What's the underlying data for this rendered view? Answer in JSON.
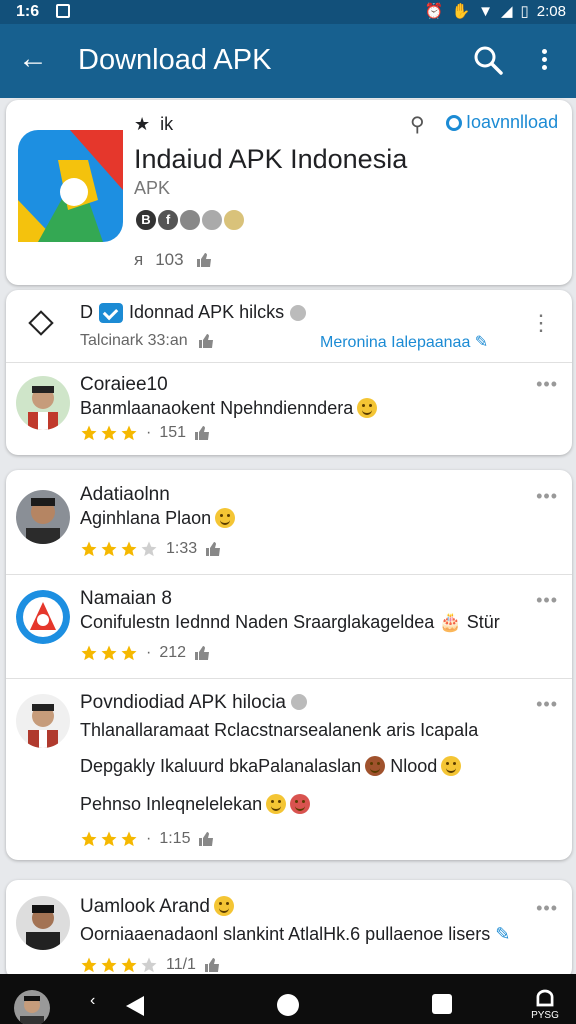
{
  "status_bar": {
    "time": "1:6",
    "clock": "2:08",
    "battery": "▯"
  },
  "app_bar": {
    "title": "Download APK",
    "back_icon": "arrow-left-icon",
    "search_icon": "search-icon",
    "more_icon": "more-vert-icon"
  },
  "app_card": {
    "tag": "ik",
    "download_label": "Ioavnnlload",
    "name": "Indaiud APK Indonesia",
    "subtitle": "APK",
    "badges": [
      "B",
      "f",
      "",
      "",
      ""
    ],
    "meta_prefix": "ᴙ",
    "meta_count": "103"
  },
  "list_header": {
    "prefix": "D",
    "title": "Idonnad APK hilcks",
    "time": "Talcinark 33:an",
    "link": "Meronina Ialepaanaa"
  },
  "reviews": [
    {
      "name": "Coraiee10",
      "text": "Banmlaanaokent Npehndienndera",
      "count": "151",
      "rating": 3
    },
    {
      "name": "Adatiaolnn",
      "text": "Aginhlana Plaon",
      "count": "1:33",
      "rating": 3.5
    },
    {
      "name": "Namaian 8",
      "text": "Conifulestn Iednnd Naden Sraarglakageldea",
      "text_suffix": "Stür",
      "count": "212",
      "rating": 3
    },
    {
      "name": "Povndiodiad APK hilocia",
      "text": "Thlanallaramaat Rclacstnarsealanenk aris Icapala",
      "text_2": "Depgakly Ikaluurd bkaPalanalaslan",
      "text_2_suffix": "Nlood",
      "text_3": "Pehnso Inleqnelelekan",
      "count": "1:15",
      "rating": 3
    },
    {
      "name": "Uamlook Arand",
      "text": "Oorniaaenadaonl slankint AtlalHk.6 pullaenoe lisers",
      "count": "11/1",
      "rating": 3.5
    }
  ],
  "nav_bar": {
    "small_label": "‹",
    "logo_label": "PYSG"
  },
  "colors": {
    "app_bar": "#17608f",
    "status_bar": "#12507a",
    "accent": "#1c8bd4",
    "star": "#f5b800"
  }
}
